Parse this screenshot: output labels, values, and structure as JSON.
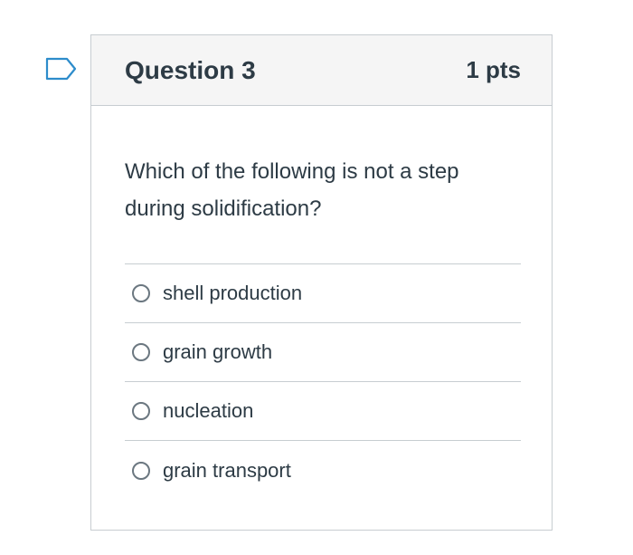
{
  "question": {
    "title": "Question 3",
    "points": "1 pts",
    "text": "Which of the following is not a step during solidification?",
    "flag_icon": "bookmark-flag-icon",
    "answers": [
      {
        "label": "shell production",
        "selected": false
      },
      {
        "label": "grain growth",
        "selected": false
      },
      {
        "label": "nucleation",
        "selected": false
      },
      {
        "label": "grain transport",
        "selected": false
      }
    ]
  },
  "colors": {
    "flag": "#2d8ccb",
    "text": "#2d3b45",
    "header_bg": "#f5f5f5",
    "border": "#c7cdd1",
    "radio_border": "#6b7780"
  }
}
